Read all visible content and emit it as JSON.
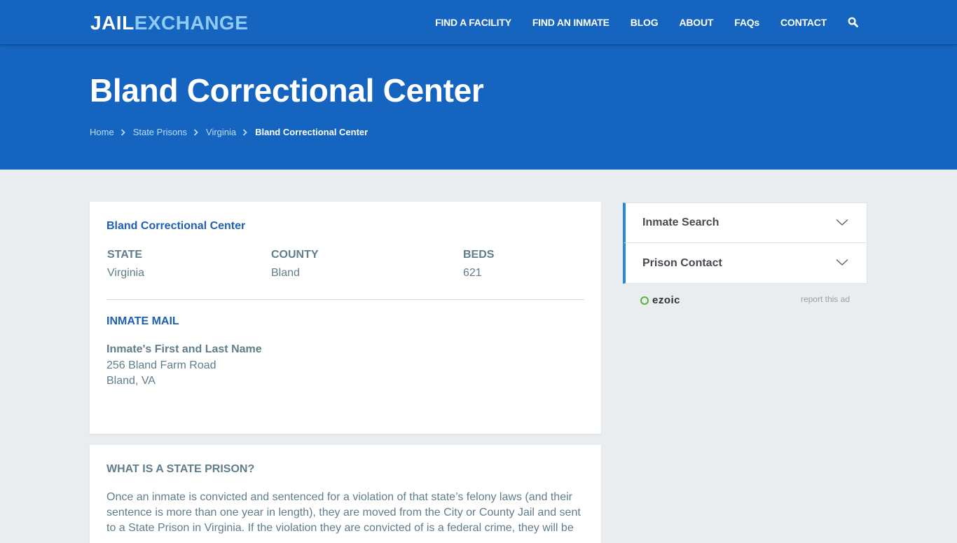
{
  "header": {
    "logo_part1": "JAIL",
    "logo_part2": "EXCHANGE",
    "nav": [
      {
        "label": "FIND A FACILITY"
      },
      {
        "label": "FIND AN INMATE"
      },
      {
        "label": "BLOG"
      },
      {
        "label": "ABOUT"
      },
      {
        "label": "FAQs"
      },
      {
        "label": "CONTACT"
      }
    ],
    "search_icon": "search-icon"
  },
  "hero": {
    "title": "Bland Correctional Center",
    "breadcrumb": [
      {
        "label": "Home"
      },
      {
        "label": "State Prisons"
      },
      {
        "label": "Virginia"
      },
      {
        "label": "Bland Correctional Center"
      }
    ]
  },
  "facility": {
    "title": "Bland Correctional Center",
    "fields": [
      {
        "label": "STATE",
        "value": "Virginia"
      },
      {
        "label": "COUNTY",
        "value": "Bland"
      },
      {
        "label": "BEDS",
        "value": "621"
      }
    ],
    "mail": {
      "title": "INMATE MAIL",
      "name_line": "Inmate's First and Last Name",
      "address_line1": "256 Bland Farm Road",
      "address_line2": "Bland, VA"
    }
  },
  "state_prison": {
    "title": "WHAT IS A STATE PRISON?",
    "body": "Once an inmate is convicted and sentenced for a violation of that state’s felony laws (and their sentence is more than one year in length), they are moved from the City or County Jail and sent to a State Prison in Virginia. If the violation they are convicted of is a federal crime, they will be"
  },
  "sidebar": {
    "accordion": [
      {
        "label": "Inmate Search"
      },
      {
        "label": "Prison Contact"
      }
    ],
    "ad_brand": "ezoic",
    "report_ad": "report this ad"
  },
  "colors": {
    "brand_blue": "#1565c0",
    "logo_accent": "#90caf9",
    "heading_blue": "#1e5fb4",
    "accordion_accent": "#2b87d8",
    "page_bg": "#e9edf0"
  }
}
